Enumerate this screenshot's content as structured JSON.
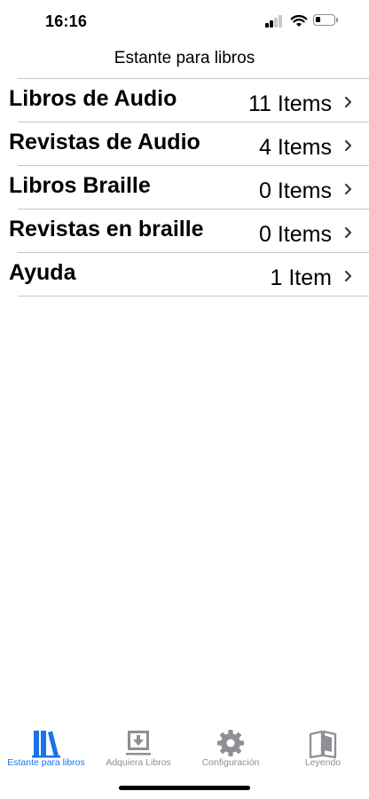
{
  "status": {
    "time": "16:16"
  },
  "nav": {
    "title": "Estante para libros"
  },
  "rows": [
    {
      "title": "Libros de Audio",
      "count": "11 Items"
    },
    {
      "title": "Revistas de Audio",
      "count": "4 Items"
    },
    {
      "title": "Libros Braille",
      "count": "0 Items"
    },
    {
      "title": "Revistas en braille",
      "count": "0 Items"
    },
    {
      "title": "Ayuda",
      "count": "1 Item"
    }
  ],
  "tabs": [
    {
      "label": "Estante para libros",
      "icon": "books-icon",
      "active": true
    },
    {
      "label": "Adquiera Libros",
      "icon": "download-tray-icon",
      "active": false
    },
    {
      "label": "Configuración",
      "icon": "gear-icon",
      "active": false
    },
    {
      "label": "Leyendo",
      "icon": "open-book-icon",
      "active": false
    }
  ],
  "colors": {
    "accent": "#1a73e8",
    "inactive": "#8e8e93",
    "separator": "#c6c6c8"
  }
}
